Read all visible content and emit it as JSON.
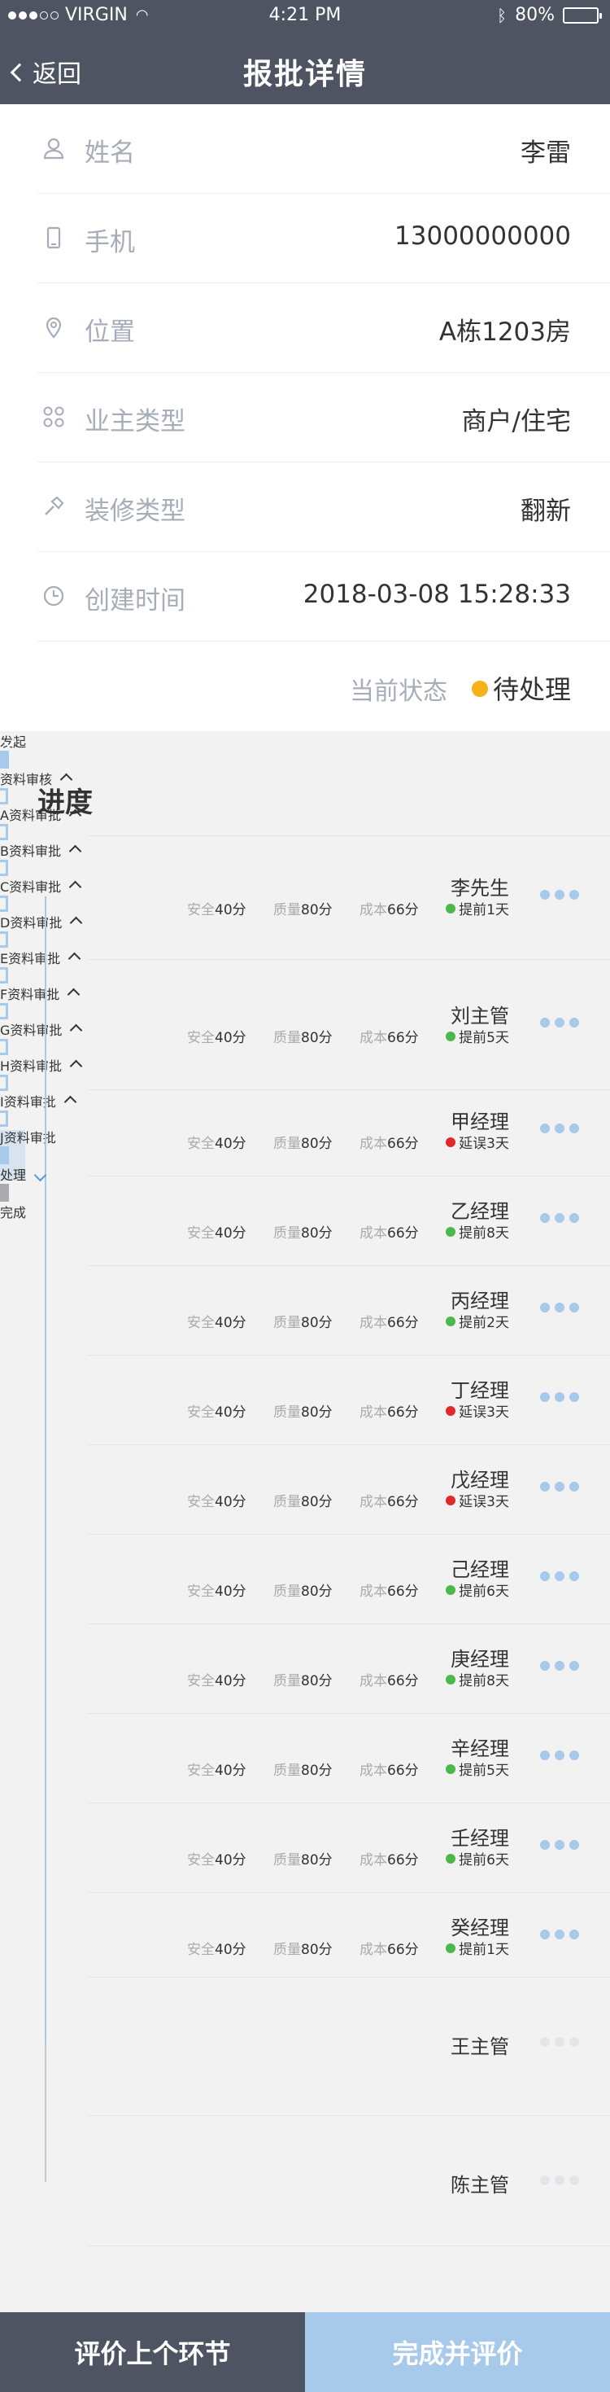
{
  "statusbar": {
    "carrier": "VIRGIN",
    "time": "4:21 PM",
    "battery": "80%",
    "battery_level": 0.8
  },
  "nav": {
    "back_label": "返回",
    "title": "报批详情"
  },
  "info": {
    "name_label": "姓名",
    "name_value": "李雷",
    "phone_label": "手机",
    "phone_value": "13000000000",
    "location_label": "位置",
    "location_value": "A栋1203房",
    "owner_type_label": "业主类型",
    "owner_type_value": "商户/住宅",
    "reno_type_label": "装修类型",
    "reno_type_value": "翻新",
    "created_label": "创建时间",
    "created_value": "2018-03-08 15:28:33",
    "state_label": "当前状态",
    "state_value": "待处理",
    "state_color": "#f7b21a"
  },
  "progress": {
    "title": "进度",
    "metric_labels": {
      "safety": "安全",
      "quality": "质量",
      "cost": "成本"
    },
    "colors": {
      "ahead": "#4cb84a",
      "delay": "#e02a2a",
      "line": "#a7c9ea"
    },
    "steps": [
      {
        "name": "发起",
        "person": "李先生",
        "safety": "40分",
        "quality": "80分",
        "cost": "66分",
        "tag": "提前1天",
        "tag_type": "ahead"
      },
      {
        "name": "资料审核",
        "person": "刘主管",
        "safety": "40分",
        "quality": "80分",
        "cost": "66分",
        "tag": "提前5天",
        "tag_type": "ahead"
      },
      {
        "name": "A资料审批",
        "person": "甲经理",
        "safety": "40分",
        "quality": "80分",
        "cost": "66分",
        "tag": "延误3天",
        "tag_type": "delay"
      },
      {
        "name": "B资料审批",
        "person": "乙经理",
        "safety": "40分",
        "quality": "80分",
        "cost": "66分",
        "tag": "提前8天",
        "tag_type": "ahead"
      },
      {
        "name": "C资料审批",
        "person": "丙经理",
        "safety": "40分",
        "quality": "80分",
        "cost": "66分",
        "tag": "提前2天",
        "tag_type": "ahead"
      },
      {
        "name": "D资料审批",
        "person": "丁经理",
        "safety": "40分",
        "quality": "80分",
        "cost": "66分",
        "tag": "延误3天",
        "tag_type": "delay"
      },
      {
        "name": "E资料审批",
        "person": "戊经理",
        "safety": "40分",
        "quality": "80分",
        "cost": "66分",
        "tag": "延误3天",
        "tag_type": "delay"
      },
      {
        "name": "F资料审批",
        "person": "己经理",
        "safety": "40分",
        "quality": "80分",
        "cost": "66分",
        "tag": "提前6天",
        "tag_type": "ahead"
      },
      {
        "name": "G资料审批",
        "person": "庚经理",
        "safety": "40分",
        "quality": "80分",
        "cost": "66分",
        "tag": "提前8天",
        "tag_type": "ahead"
      },
      {
        "name": "H资料审批",
        "person": "辛经理",
        "safety": "40分",
        "quality": "80分",
        "cost": "66分",
        "tag": "提前5天",
        "tag_type": "ahead"
      },
      {
        "name": "I资料审批",
        "person": "壬经理",
        "safety": "40分",
        "quality": "80分",
        "cost": "66分",
        "tag": "提前6天",
        "tag_type": "ahead"
      },
      {
        "name": "J资料审批",
        "person": "癸经理",
        "safety": "40分",
        "quality": "80分",
        "cost": "66分",
        "tag": "提前1天",
        "tag_type": "ahead"
      },
      {
        "name": "处理",
        "person": "王主管"
      },
      {
        "name": "完成",
        "person": "陈主管"
      }
    ]
  },
  "actions": {
    "prev_label": "评价上个环节",
    "next_label": "完成并评价"
  }
}
